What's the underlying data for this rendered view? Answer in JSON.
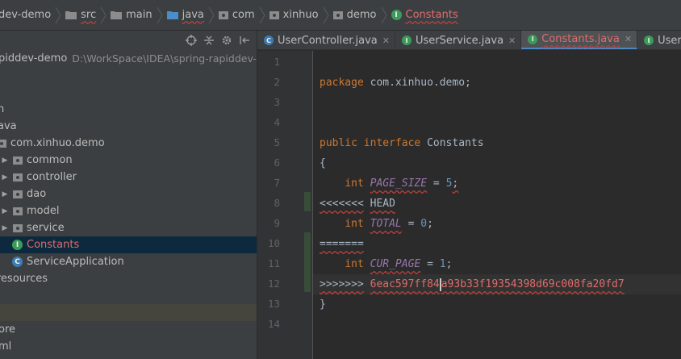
{
  "breadcrumb": {
    "items": [
      "dev-demo",
      "src",
      "main",
      "java",
      "com",
      "xinhuo",
      "demo",
      "Constants"
    ]
  },
  "project": {
    "root_name": "piddev-demo",
    "root_path": "D:\\WorkSpace\\IDEA\\spring-rapiddev-de",
    "tree": [
      {
        "label": "n"
      },
      {
        "label": "ava"
      },
      {
        "label": "com.xinhuo.demo"
      },
      {
        "label": "common"
      },
      {
        "label": "controller"
      },
      {
        "label": "dao"
      },
      {
        "label": "model"
      },
      {
        "label": "service"
      },
      {
        "label": "Constants"
      },
      {
        "label": "ServiceApplication"
      },
      {
        "label": "resources"
      },
      {
        "label": ""
      },
      {
        "label": "ore"
      },
      {
        "label": "ml"
      }
    ],
    "icons": {
      "class_icon_letter": "I",
      "class_icon_color": "#3d9b5a",
      "app_icon_color": "#3e7bb5"
    }
  },
  "tabs": [
    {
      "label": "UserController.java",
      "icon": "class-c-icon",
      "active": false
    },
    {
      "label": "UserService.java",
      "icon": "interface-i-icon",
      "active": false
    },
    {
      "label": "Constants.java",
      "icon": "interface-i-icon",
      "active": true
    },
    {
      "label": "UserMapp",
      "icon": "interface-i-icon",
      "active": false
    }
  ],
  "tab_icon_letters": {
    "class": "C",
    "interface": "I"
  },
  "editor": {
    "line_numbers": [
      "1",
      "2",
      "3",
      "4",
      "5",
      "6",
      "7",
      "8",
      "9",
      "10",
      "11",
      "12",
      "13",
      "14"
    ],
    "code": {
      "l2_kw": "package",
      "l2_rest": " com.xinhuo.demo;",
      "l5_kw1": "public",
      "l5_kw2": "interface",
      "l5_rest": " Constants",
      "l6": "{",
      "l7_kw": "int",
      "l7_const": "PAGE_SIZE",
      "l7_eq": " = ",
      "l7_num": "5",
      "l7_end": ";",
      "l8_marker": "<<<<<<<",
      "l8_rest": "HEAD",
      "l9_kw": "int",
      "l9_const": "TOTAL",
      "l9_eq": " = ",
      "l9_num": "0",
      "l9_end": ";",
      "l10": "=======",
      "l11_kw": "int",
      "l11_const": "CUR_PAGE",
      "l11_eq": " = ",
      "l11_num": "1",
      "l11_end": ";",
      "l12_marker": ">>>>>>>",
      "l12_hash_a": "6eac597ff84",
      "l12_hash_b": "a93b33f19354398d69c008fa20fd7",
      "l13": "}"
    }
  }
}
